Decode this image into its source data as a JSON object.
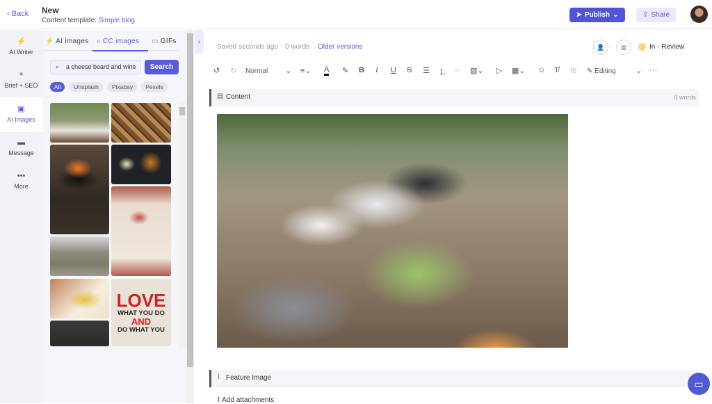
{
  "header": {
    "back": "Back",
    "title": "New",
    "template_label": "Content template:",
    "template_value": "Simple blog",
    "publish": "Publish",
    "share": "Share"
  },
  "rail": {
    "items": [
      {
        "label": "AI Writer",
        "icon": "lightning-icon"
      },
      {
        "label": "Brief + SEO",
        "icon": "target-icon"
      },
      {
        "label": "AI Images",
        "icon": "image-icon",
        "active": true
      },
      {
        "label": "Message",
        "icon": "message-icon"
      },
      {
        "label": "More",
        "icon": "more-icon"
      }
    ]
  },
  "panel": {
    "tabs": [
      {
        "label": "AI images"
      },
      {
        "label": "CC images",
        "active": true
      },
      {
        "label": "GIFs"
      }
    ],
    "search": {
      "value": "a cheese board and wine",
      "button": "Search"
    },
    "filters": [
      {
        "label": "All",
        "active": true
      },
      {
        "label": "Unsplash"
      },
      {
        "label": "Pixabay"
      },
      {
        "label": "Pexels"
      }
    ],
    "sign_text": {
      "line1": "LOVE",
      "line2": "WHAT YOU DO",
      "line3": "AND",
      "line4": "DO WHAT YOU"
    }
  },
  "editor": {
    "saved": "Saved seconds ago",
    "words": "0 words",
    "older": "Older versions",
    "status": "In - Review",
    "status_color": "#f6d58a",
    "toolbar": {
      "style": "Normal",
      "mode": "Editing"
    },
    "content_label": "Content",
    "content_words": "0 words",
    "feature_label": "Feature Image",
    "attachments": "Add attachments"
  },
  "colors": {
    "accent": "#5b5bd6"
  }
}
